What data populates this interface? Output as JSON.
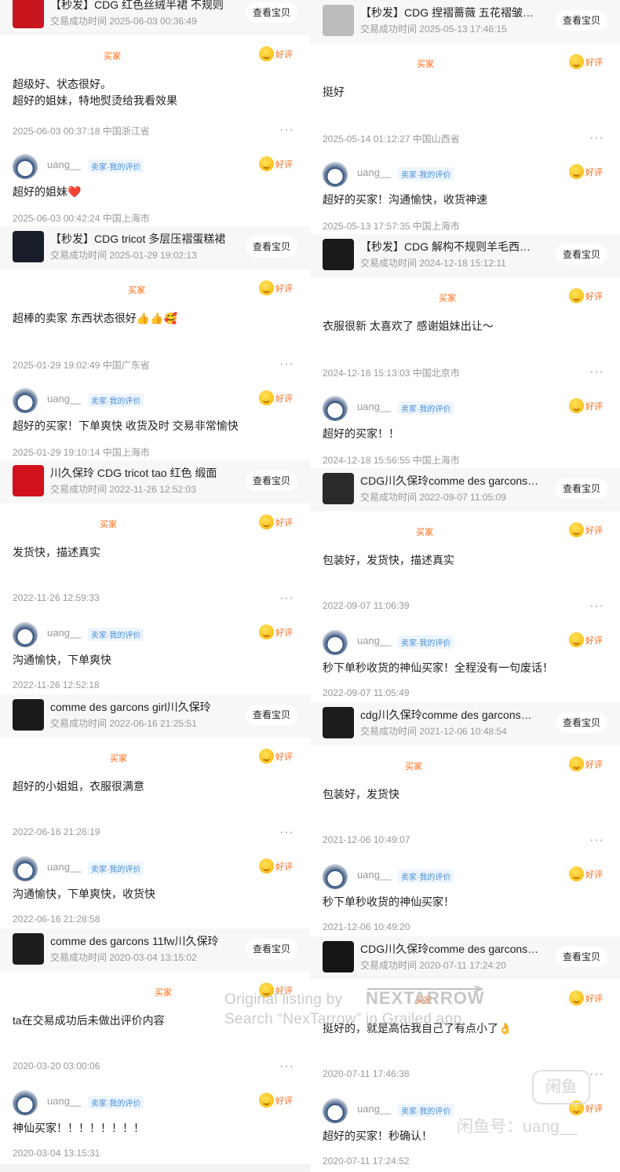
{
  "view_button_label": "查看宝贝",
  "good_label": "好评",
  "buyer_role": "买家",
  "seller_tag": "卖家·我的评价",
  "username": "uang__",
  "columns": [
    [
      {
        "product": {
          "title": "【秒发】CDG 红色丝绒半裙 不规则",
          "time": "交易成功时间 2025-06-03 00:36:49"
        },
        "buyer": {
          "text": "超级好、状态很好。\n超好的姐妹，特地熨烫给我看效果",
          "time": "2025-06-03 00:37:18  中国浙江省"
        },
        "seller": {
          "text": "超好的姐妹❤️",
          "time": "2025-06-03 00:42:24  中国上海市"
        }
      },
      {
        "product": {
          "title": "【秒发】CDG tricot 多层压褶蛋糕裙",
          "time": "交易成功时间 2025-01-29 19:02:13"
        },
        "buyer": {
          "text": "超棒的卖家 东西状态很好👍👍🥰",
          "time": "2025-01-29 19:02:49  中国广东省"
        },
        "seller": {
          "text": "超好的买家！下单爽快 收货及时 交易非常愉快",
          "time": "2025-01-29 19:10:14  中国上海市"
        }
      },
      {
        "product": {
          "title": "川久保玲 CDG tricot tao 红色 缎面",
          "time": "交易成功时间 2022-11-26 12:52:03"
        },
        "buyer": {
          "text": "发货快，描述真实",
          "time": "2022-11-26 12:59:33"
        },
        "seller": {
          "text": "沟通愉快，下单爽快",
          "time": "2022-11-26 12:52:18"
        }
      },
      {
        "product": {
          "title": "comme des garcons girl川久保玲",
          "time": "交易成功时间 2022-06-16 21:25:51"
        },
        "buyer": {
          "text": "超好的小姐姐，衣服很满意",
          "time": "2022-06-16 21:26:19"
        },
        "seller": {
          "text": "沟通愉快，下单爽快，收货快",
          "time": "2022-06-16 21:28:58"
        }
      },
      {
        "product": {
          "title": "comme des garcons 11fw川久保玲",
          "time": "交易成功时间 2020-03-04 13:15:02"
        },
        "buyer": {
          "text": "ta在交易成功后未做出评价内容",
          "time": "2020-03-20 03:00:06"
        },
        "seller": {
          "text": "神仙买家！！！！！！！！",
          "time": "2020-03-04 13:15:31"
        }
      }
    ],
    [
      {
        "product": {
          "title": "【秒发】CDG 捏褶蔷薇 五花褶皱衬衫",
          "time": "交易成功时间 2025-05-13 17:46:15"
        },
        "buyer": {
          "text": "挺好",
          "time": "2025-05-14 01:12:27  中国山西省"
        },
        "seller": {
          "text": "超好的买家！沟通愉快，收货神速",
          "time": "2025-05-13 17:57:35  中国上海市"
        }
      },
      {
        "product": {
          "title": "【秒发】CDG 解构不规则羊毛西装外套",
          "time": "交易成功时间 2024-12-18 15:12:11"
        },
        "buyer": {
          "text": "衣服很新 太喜欢了 感谢姐妹出让～",
          "time": "2024-12-18 15:13:03  中国北京市"
        },
        "seller": {
          "text": "超好的买家！！",
          "time": "2024-12-18 15:56:55  中国上海市"
        }
      },
      {
        "product": {
          "title": "CDG川久保玲comme des garcons外套",
          "time": "交易成功时间 2022-09-07 11:05:09"
        },
        "buyer": {
          "text": "包装好，发货快，描述真实",
          "time": "2022-09-07 11:06:39"
        },
        "seller": {
          "text": "秒下单秒收货的神仙买家！全程没有一句废话！",
          "time": "2022-09-07 11:05:49"
        }
      },
      {
        "product": {
          "title": "cdg川久保玲comme des garcons外套",
          "time": "交易成功时间 2021-12-06 10:48:54"
        },
        "buyer": {
          "text": "包装好，发货快",
          "time": "2021-12-06 10:49:07"
        },
        "seller": {
          "text": "秒下单秒收货的神仙买家！",
          "time": "2021-12-06 10:49:20"
        }
      },
      {
        "product": {
          "title": "CDG川久保玲comme des garcons外套",
          "time": "交易成功时间 2020-07-11 17:24:20"
        },
        "buyer": {
          "text": "挺好的，就是高估我自己了有点小了👌",
          "time": "2020-07-11 17:46:38"
        },
        "seller": {
          "text": "超好的买家！秒确认！",
          "time": "2020-07-11 17:24:52"
        }
      }
    ]
  ],
  "thumb_colors": [
    [
      "#c8141c",
      "#1a1d2a",
      "#d1111b",
      "#1a1a1a",
      "#1d1d1d"
    ],
    [
      "#bcbcbc",
      "#1a1a1a",
      "#2a2a2a",
      "#1c1c1c",
      "#151515"
    ]
  ],
  "watermark": {
    "line1": "Original listing by",
    "brand": "NEXTARROW",
    "line2": "Search “NexTarrow” in Grailed app.",
    "app_badge": "闲鱼",
    "app_text": "闲鱼号：uang__"
  }
}
